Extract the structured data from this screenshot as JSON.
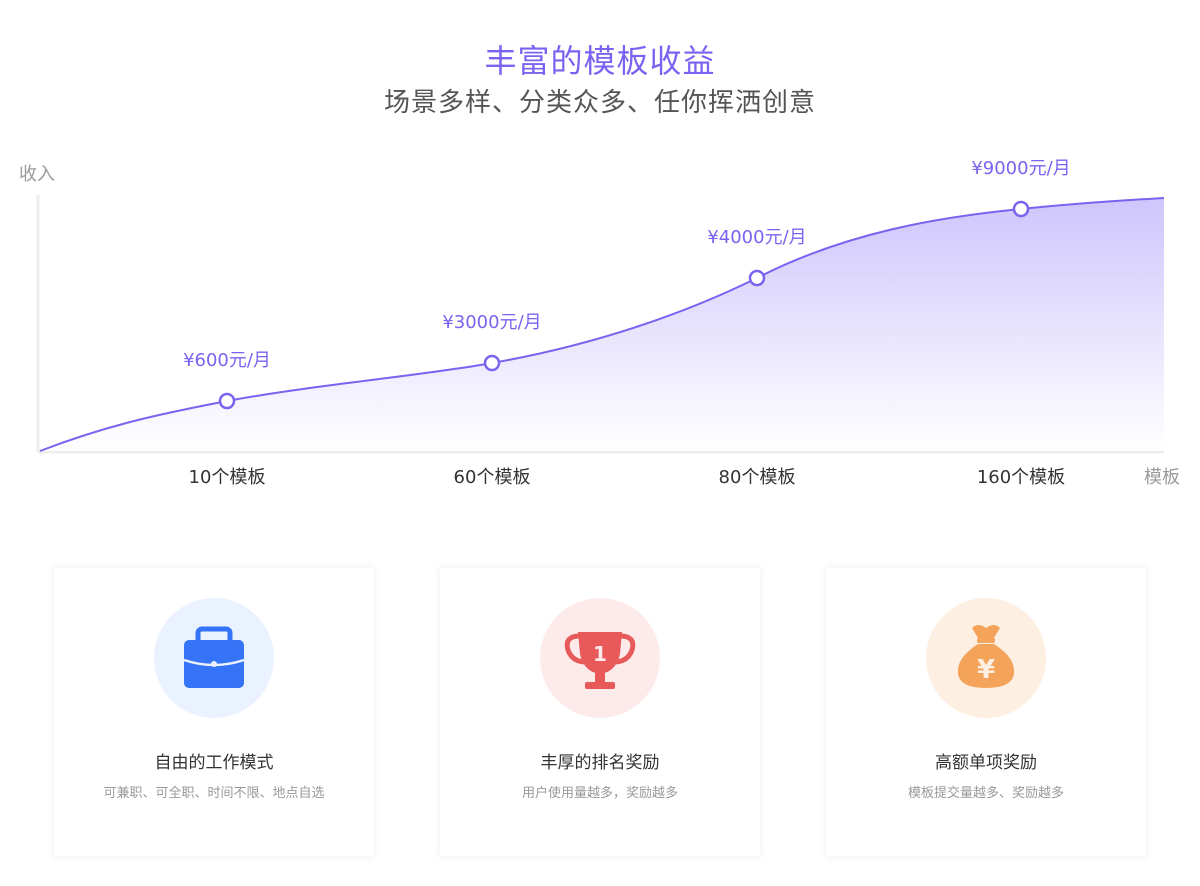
{
  "header": {
    "title": "丰富的模板收益",
    "subtitle": "场景多样、分类众多、任你挥洒创意"
  },
  "chart_data": {
    "type": "area",
    "ylabel": "收入",
    "xlabel": "模板",
    "categories": [
      "10个模板",
      "60个模板",
      "80个模板",
      "160个模板"
    ],
    "data_labels": [
      "¥600元/月",
      "¥3000元/月",
      "¥4000元/月",
      "¥9000元/月"
    ],
    "colors": {
      "line": "#7a63f0",
      "fill_top": "#c9bffb",
      "point_fill": "#ffffff",
      "axis": "#eeeeee",
      "label": "#7a63f0"
    }
  },
  "cards": [
    {
      "title": "自由的工作模式",
      "desc": "可兼职、可全职、时间不限、地点自选",
      "icon": "briefcase-icon",
      "circle_color": "#eaf1ff",
      "icon_color": "#3574f6"
    },
    {
      "title": "丰厚的排名奖励",
      "desc": "用户使用量越多，奖励越多",
      "icon": "trophy-icon",
      "circle_color": "#fdebeb",
      "icon_color": "#e85a5a",
      "icon_text": "1"
    },
    {
      "title": "高额单项奖励",
      "desc": "模板提交量越多、奖励越多",
      "icon": "money-bag-icon",
      "circle_color": "#fdf0e3",
      "icon_color": "#f4a35a",
      "icon_text": "¥"
    }
  ]
}
